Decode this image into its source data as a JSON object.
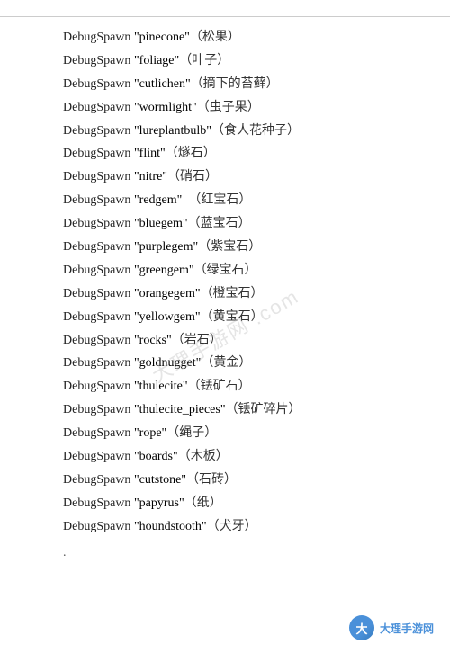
{
  "divider": true,
  "watermark": "大理手游网 .com",
  "items": [
    {
      "prefix": "DebugSpawn",
      "en": "\"pinecone\"",
      "cn": "（松果）"
    },
    {
      "prefix": "DebugSpawn",
      "en": "\"foliage\"",
      "cn": "（叶子）"
    },
    {
      "prefix": "DebugSpawn",
      "en": "\"cutlichen\"",
      "cn": "（摘下的苔藓）"
    },
    {
      "prefix": "DebugSpawn",
      "en": "\"wormlight\"",
      "cn": "（虫子果）"
    },
    {
      "prefix": "DebugSpawn",
      "en": "\"lureplantbulb\"",
      "cn": "（食人花种子）"
    },
    {
      "prefix": "DebugSpawn",
      "en": "\"flint\"",
      "cn": "（燧石）"
    },
    {
      "prefix": "DebugSpawn",
      "en": "\"nitre\"",
      "cn": "（硝石）"
    },
    {
      "prefix": "DebugSpawn",
      "en": "\"redgem\"",
      "cn": "　（红宝石）"
    },
    {
      "prefix": "DebugSpawn",
      "en": "\"bluegem\"",
      "cn": "（蓝宝石）"
    },
    {
      "prefix": "DebugSpawn",
      "en": "\"purplegem\"",
      "cn": "（紫宝石）"
    },
    {
      "prefix": "DebugSpawn",
      "en": "\"greengem\"",
      "cn": "（绿宝石）"
    },
    {
      "prefix": "DebugSpawn",
      "en": "\"orangegem\"",
      "cn": "（橙宝石）"
    },
    {
      "prefix": "DebugSpawn",
      "en": "\"yellowgem\"",
      "cn": "（黄宝石）"
    },
    {
      "prefix": "DebugSpawn",
      "en": "\"rocks\"",
      "cn": "（岩石）"
    },
    {
      "prefix": "DebugSpawn",
      "en": "\"goldnugget\"",
      "cn": "（黄金）"
    },
    {
      "prefix": "DebugSpawn",
      "en": "\"thulecite\"",
      "cn": "（铥矿石）"
    },
    {
      "prefix": "DebugSpawn",
      "en": "\"thulecite_pieces\"",
      "cn": "（铥矿碎片）"
    },
    {
      "prefix": "DebugSpawn",
      "en": "\"rope\"",
      "cn": "（绳子）"
    },
    {
      "prefix": "DebugSpawn",
      "en": "\"boards\"",
      "cn": "（木板）"
    },
    {
      "prefix": "DebugSpawn",
      "en": "\"cutstone\"",
      "cn": "（石砖）"
    },
    {
      "prefix": "DebugSpawn",
      "en": "\"papyrus\"",
      "cn": "（纸）"
    },
    {
      "prefix": "DebugSpawn",
      "en": "\"houndstooth\"",
      "cn": "（犬牙）"
    }
  ],
  "bottom_dot": ".",
  "logo": {
    "icon_text": "大",
    "label": "大理手游网"
  }
}
